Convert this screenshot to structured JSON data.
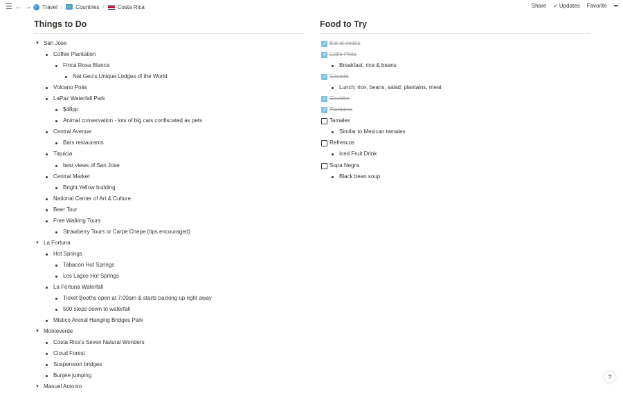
{
  "topbar": {
    "breadcrumbs": [
      "Travel",
      "Countries",
      "Costa Rica"
    ],
    "actions": {
      "share": "Share",
      "updates": "Updates",
      "favorite": "Favorite",
      "more": "•••"
    }
  },
  "things": {
    "title": "Things to Do",
    "items": [
      "San Jose",
      "Coffee Plantation",
      "Finca Rosa Blanca",
      "Nat Geo's Unique Lodges of the World",
      "Volcano Poás",
      "LaPaz Waterfall Park",
      "$48pp",
      "Animal conservation - lots of big cats confiscated as pets",
      "Central Avenue",
      "Bars restaurants",
      "Tiquicia",
      "best views of San Jose",
      "Central Market",
      "Bright Yellow building",
      "National Center of Art & Culture",
      "Beer Tour",
      "Free Walking Tours",
      "Strawberry Tours or Carpe Chepe (tips encouraged)",
      "La Fortuna",
      "Hot Springs",
      "Tabacon Hot Springs",
      "Los Lagos Hot Springs",
      "La Fortuna Waterfall",
      "Ticket Booths open at 7:00am & starts packing up right away",
      "500 steps down to waterfall",
      "Mistico Arenal Hanging Bridges Park",
      "Monteverde",
      "Costa Rica's Seven Natural Wonders",
      "Cloud Forest",
      "Suspension bridges",
      "Bunjee jumping",
      "Manuel Antonio"
    ]
  },
  "food": {
    "title": "Food to Try",
    "items": [
      {
        "text": "Eat at sodas",
        "checked": true
      },
      {
        "text": "Gallo Pinto",
        "checked": true
      },
      {
        "text": "Breakfast, rice & beans"
      },
      {
        "text": "Casado",
        "checked": true
      },
      {
        "text": "Lunch; rice, beans, salad, plantains, meat"
      },
      {
        "text": "Ceviche",
        "checked": true
      },
      {
        "text": "Plantains",
        "checked": true
      },
      {
        "text": "Tamales",
        "checked": false
      },
      {
        "text": "Similar to Mexican tamales"
      },
      {
        "text": "Refrescos",
        "checked": false
      },
      {
        "text": "Iced Fruit Drink"
      },
      {
        "text": "Sopa Negra",
        "checked": false
      },
      {
        "text": "Black bean soup"
      }
    ]
  },
  "help": "?",
  "colors": {
    "text": "#37352f",
    "checkbox_checked": "#7cc0e3",
    "muted": "#9b9a97"
  }
}
